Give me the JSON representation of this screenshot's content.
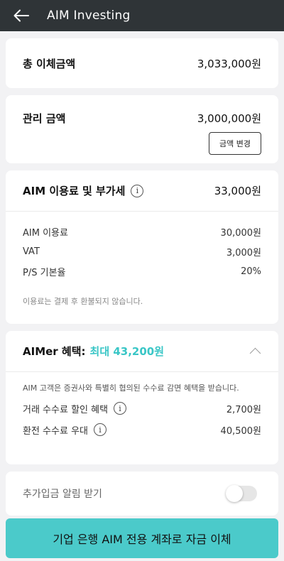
{
  "header": {
    "title": "AIM Investing",
    "back_icon": "arrow-left-icon"
  },
  "total_transfer": {
    "label": "총 이체금액",
    "value": "3,033,000원"
  },
  "managed_amount": {
    "label": "관리 금액",
    "value": "3,000,000원",
    "change_button": "금액 변경"
  },
  "fee": {
    "label": "AIM 이용료 및 부가세",
    "value": "33,000원",
    "info_icon": "info-icon",
    "items": [
      {
        "label": "AIM 이용료",
        "value": "30,000원"
      },
      {
        "label": "VAT",
        "value": "3,000원"
      },
      {
        "label": "P/S 기본율",
        "value": "20%"
      }
    ],
    "note": "이용료는 결제 후 환불되지 않습니다."
  },
  "aimer": {
    "title": "AIMer 혜택:",
    "highlight": "최대 43,200원",
    "accent_color": "#39c6c6",
    "description": "AIM 고객은 증권사와 특별히 협의된 수수료 감면 혜택을 받습니다.",
    "items": [
      {
        "label": "거래 수수료 할인 혜택",
        "value": "2,700원"
      },
      {
        "label": "환전 수수료 우대",
        "value": "40,500원"
      }
    ]
  },
  "deposit_alert": {
    "label": "추가입금 알림 받기",
    "enabled": false
  },
  "transfer_button": {
    "label": "기업 은행 AIM 전용 계좌로 자금 이체",
    "color": "#4bcaca"
  }
}
